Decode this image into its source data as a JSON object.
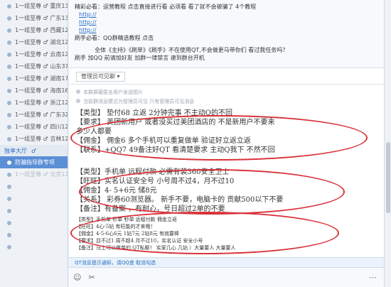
{
  "sidebar": {
    "items": [
      {
        "label": "1一组至尊 ♂ 重庆13650"
      },
      {
        "label": "1一组至尊 ♂ 广东13744"
      },
      {
        "label": "1一组至尊 ♂ 西藏12027"
      },
      {
        "label": "1一组至尊 ♂ 湖北12458"
      },
      {
        "label": "1一组至尊 ♂ 云南12036"
      },
      {
        "label": "1一组至尊 ♂ 山东37300"
      },
      {
        "label": "1一组至尊 ♂ 湖南17900"
      },
      {
        "label": "1一组至尊 ♂ 海南16475"
      },
      {
        "label": "1一组至尊 ♂ 浙江12671"
      },
      {
        "label": "1一组至尊 ♂ 广东32450"
      },
      {
        "label": "1一组至尊 ♂ 四川12960"
      },
      {
        "label": "1一组至尊 ♂ 吉林12026"
      },
      {
        "label": "1一组至尊 ♂ 北京12606"
      }
    ],
    "tabs": [
      "独享大厅",
      "♂"
    ],
    "active_item": "防骗指导群专项"
  },
  "pinned": {
    "line1": "精彩必看：运营教程 点击直接进行看 必须看 看了就不会被骗了 4个教程",
    "link1": "http://",
    "link2": "http://",
    "link3": "http://",
    "line5": "刷手必看：QQ群精选教程 点击",
    "line6": "全体《主持》《刷单》《刷手》不在使用QT,不会做更马带你们    看过我任务吗？",
    "line7": "刷手 加QQ 前请加好友    加群一律禁言    速到群台开机"
  },
  "toolbar": {
    "dropdown": "管理员可见聊 ▾"
  },
  "system": {
    "line1": "本群屏蔽匿名用户发送图片",
    "line2": "当前群消息模式为管理员可见 只有管理员可见消息"
  },
  "block1": [
    "【类型】   垫付68 立返   2分钟完事   不主动Q的不回",
    "【要求】 美团新用户  或者没买过美团酒店的              不是新用户不要来",
    "           多少人都要",
    "【佣金】   佣金6 多个手机可以重复做单  验证好立返立返",
    "【联系】+QQ7          49备注好QT  看清楚要求  主动Q我下  不然不回"
  ],
  "block2": [
    "【类型】手机单  远程付款   必需有装360安全卫士",
    "【旺旺】实名认证安全号   小号周不过4，月不过10",
    "【佣金】4- 5+6元  储8元",
    "【关系】  彩券60测览器。 新手不要，电脑卡的 贡献500以下不要",
    "【备注】有备案 ，有耐心，号日超过2单的不要"
  ],
  "block3": [
    "【类型】手机单  秒单  秒单  远程付款  佣金立返",
    "【旺旺】4心-5钻  有旺能的才来哦！",
    "【佣金】4-5-6心6元 1钻7元 2钻8元 有就要棒",
    "【要求】目不过1  周不超4 月不过10，实名认证 安全小号",
    "【备注】马上可以做单的  QT私聊！ 实家几心 几钻 ）大量要人  大量要人"
  ],
  "notice": "QT消息提示通知，请QQ查  取消勾选",
  "input_icons": [
    "☺",
    "✂",
    "⋯"
  ],
  "colors": {
    "ellipse": "#d8323a",
    "link": "#2a6fc6",
    "active": "#5b8fd6"
  }
}
